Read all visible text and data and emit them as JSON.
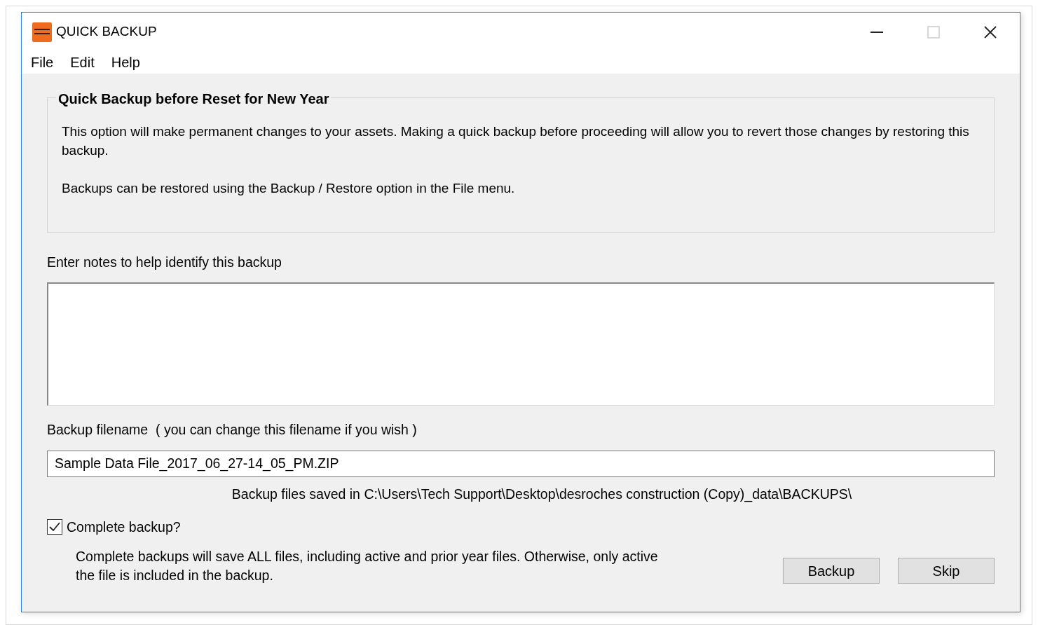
{
  "window": {
    "title": "QUICK BACKUP"
  },
  "menu": [
    {
      "label": "File"
    },
    {
      "label": "Edit"
    },
    {
      "label": "Help"
    }
  ],
  "group": {
    "title": "Quick Backup before Reset for New Year",
    "paragraphs": [
      "This option will make permanent changes to your assets.  Making a quick backup before proceeding will allow you to revert those changes by restoring this backup.",
      "Backups can be restored using the Backup / Restore option in the File menu."
    ]
  },
  "notes": {
    "label": "Enter notes to help identify this backup"
  },
  "filename": {
    "label": "Backup filename  ( you can change this filename if you wish )",
    "value": "Sample Data File_2017_06_27-14_05_PM.ZIP"
  },
  "save_location": "Backup files saved in C:\\Users\\Tech Support\\Desktop\\desroches construction (Copy)_data\\BACKUPS\\",
  "complete_backup": {
    "label": "Complete backup?",
    "checked": true,
    "description": "Complete backups will save ALL files, including active and prior year files.  Otherwise, only active the file is included in the backup."
  },
  "buttons": [
    {
      "label": "Backup"
    },
    {
      "label": "Skip"
    }
  ]
}
